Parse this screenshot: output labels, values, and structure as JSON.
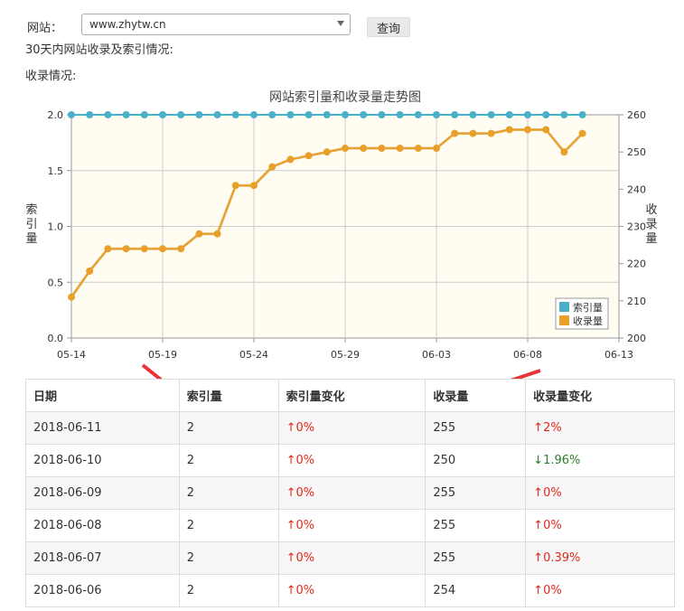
{
  "form": {
    "site_label": "网站：",
    "site_value": "www.zhytw.cn",
    "query_label": "查询"
  },
  "summary_line": "30天内网站收录及索引情况:",
  "section_label": "收录情况:",
  "chart_data": {
    "type": "line",
    "title": "网站索引量和收录量走势图",
    "x": [
      "05-14",
      "05-15",
      "05-16",
      "05-17",
      "05-18",
      "05-19",
      "05-20",
      "05-21",
      "05-22",
      "05-23",
      "05-24",
      "05-25",
      "05-26",
      "05-27",
      "05-28",
      "05-29",
      "05-30",
      "05-31",
      "06-01",
      "06-02",
      "06-03",
      "06-04",
      "06-05",
      "06-06",
      "06-07",
      "06-08",
      "06-09",
      "06-10",
      "06-11"
    ],
    "x_tick_labels": [
      "05-14",
      "05-19",
      "05-24",
      "05-29",
      "06-03",
      "06-08",
      "06-13"
    ],
    "y_left_label": "索引量",
    "y_right_label": "收录量",
    "y_left_ticks": [
      "0.0",
      "0.5",
      "1.0",
      "1.5",
      "2.0"
    ],
    "y_right_ticks": [
      "200",
      "210",
      "220",
      "230",
      "240",
      "250",
      "260"
    ],
    "y_left_lim": [
      0,
      2
    ],
    "y_right_lim": [
      200,
      260
    ],
    "series": [
      {
        "name": "索引量",
        "axis": "left",
        "color": "#4ab0c8",
        "values": [
          2,
          2,
          2,
          2,
          2,
          2,
          2,
          2,
          2,
          2,
          2,
          2,
          2,
          2,
          2,
          2,
          2,
          2,
          2,
          2,
          2,
          2,
          2,
          2,
          2,
          2,
          2,
          2,
          2
        ]
      },
      {
        "name": "收录量",
        "axis": "right",
        "color": "#e8a02b",
        "values": [
          211,
          218,
          224,
          224,
          224,
          224,
          224,
          228,
          228,
          241,
          241,
          246,
          248,
          249,
          250,
          251,
          251,
          251,
          251,
          251,
          251,
          255,
          255,
          255,
          256,
          256,
          256,
          250,
          255
        ]
      }
    ],
    "legend_position": "bottom-right",
    "grid": true
  },
  "table": {
    "headers": [
      "日期",
      "索引量",
      "索引量变化",
      "收录量",
      "收录量变化"
    ],
    "rows": [
      {
        "date": "2018-06-11",
        "index": "2",
        "index_change": "↑0%",
        "index_dir": "up",
        "count": "255",
        "count_change": "↑2%",
        "count_dir": "up"
      },
      {
        "date": "2018-06-10",
        "index": "2",
        "index_change": "↑0%",
        "index_dir": "up",
        "count": "250",
        "count_change": "↓1.96%",
        "count_dir": "down"
      },
      {
        "date": "2018-06-09",
        "index": "2",
        "index_change": "↑0%",
        "index_dir": "up",
        "count": "255",
        "count_change": "↑0%",
        "count_dir": "up"
      },
      {
        "date": "2018-06-08",
        "index": "2",
        "index_change": "↑0%",
        "index_dir": "up",
        "count": "255",
        "count_change": "↑0%",
        "count_dir": "up"
      },
      {
        "date": "2018-06-07",
        "index": "2",
        "index_change": "↑0%",
        "index_dir": "up",
        "count": "255",
        "count_change": "↑0.39%",
        "count_dir": "up"
      },
      {
        "date": "2018-06-06",
        "index": "2",
        "index_change": "↑0%",
        "index_dir": "up",
        "count": "254",
        "count_change": "↑0%",
        "count_dir": "up"
      }
    ]
  },
  "colors": {
    "annotation_arrow": "#e8333a",
    "up": "#e2281a",
    "down": "#2b7d2b"
  }
}
